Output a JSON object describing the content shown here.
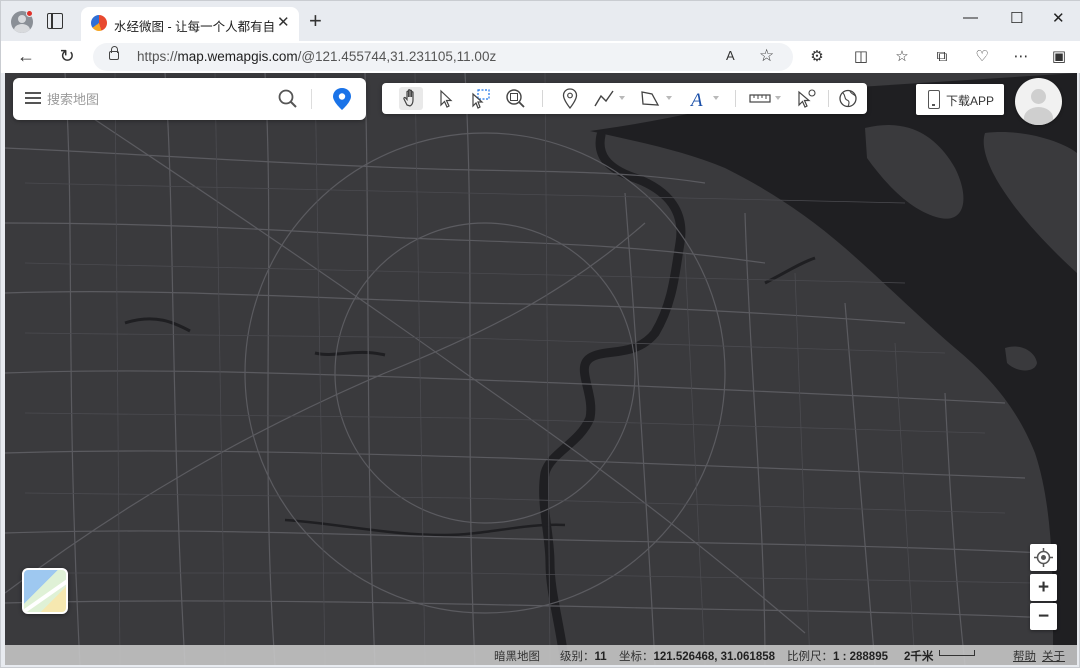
{
  "browser": {
    "tab_title": "水经微图 - 让每一个人都有自己的",
    "tab_close": "✕",
    "new_tab": "+",
    "url_scheme": "https://",
    "url_host": "map.wemapgis.com",
    "url_path": "/@121.455744,31.231105,11.00z",
    "read_aloud_icon": "A",
    "window_controls": [
      "—",
      "☐",
      "✕"
    ]
  },
  "map": {
    "search_placeholder": "搜索地图",
    "download_label": "下载APP",
    "zoom_in": "+",
    "zoom_out": "−",
    "toolbar_tools": [
      "pan-hand",
      "select-arrow",
      "box-select",
      "zoom-region",
      "marker",
      "polyline",
      "polygon",
      "text",
      "measure",
      "identify",
      "globe"
    ]
  },
  "status": {
    "basemap": "暗黑地图",
    "level_label": "级别：",
    "level_value": "11",
    "coord_label": "坐标：",
    "coord_value": "121.526468, 31.061858",
    "scale_label": "比例尺：",
    "scale_value": "1 : 288895",
    "scale_bar_text": "2千米",
    "help": "帮助",
    "about": "关于"
  },
  "colors": {
    "map_land": "#3a3a3d",
    "map_water": "#1f1f22",
    "roads": "#5d5d62",
    "location_accent": "#1a73e8"
  }
}
